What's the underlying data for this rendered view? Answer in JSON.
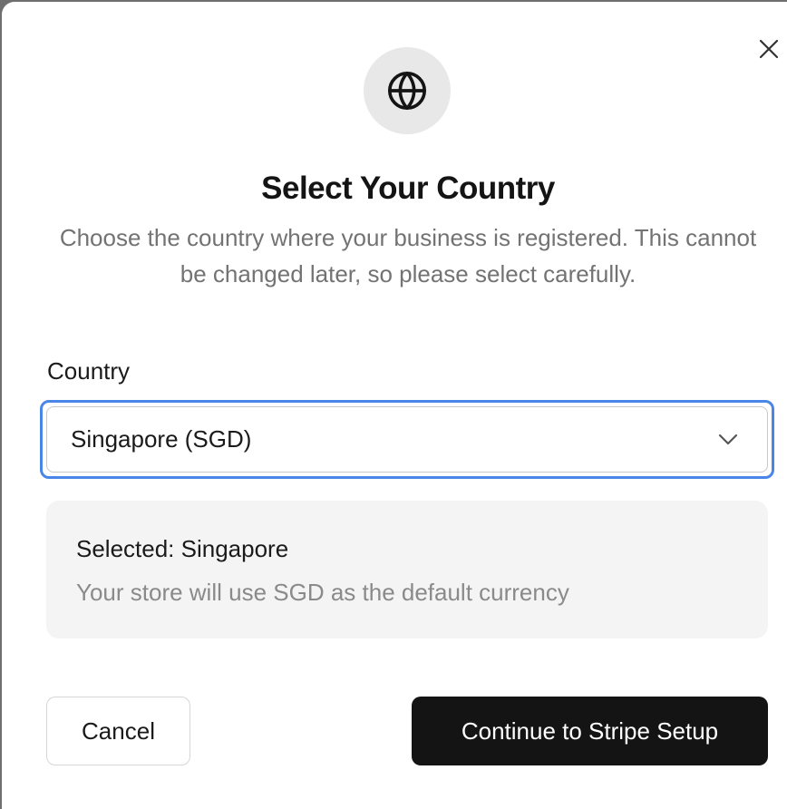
{
  "dialog": {
    "title": "Select Your Country",
    "description": "Choose the country where your business is registered. This cannot be changed later, so please select carefully.",
    "close_icon": "close-icon",
    "header_icon": "globe-icon"
  },
  "form": {
    "country_label": "Country",
    "country_value": "Singapore (SGD)",
    "dropdown_icon": "chevron-down-icon"
  },
  "selection_info": {
    "title": "Selected: Singapore",
    "description": "Your store will use SGD as the default currency"
  },
  "actions": {
    "cancel_label": "Cancel",
    "continue_label": "Continue to Stripe Setup"
  },
  "colors": {
    "primary_button": "#141414",
    "focus_ring": "#4a86e8",
    "info_background": "#f4f4f4",
    "icon_circle": "#e8e8e8"
  }
}
